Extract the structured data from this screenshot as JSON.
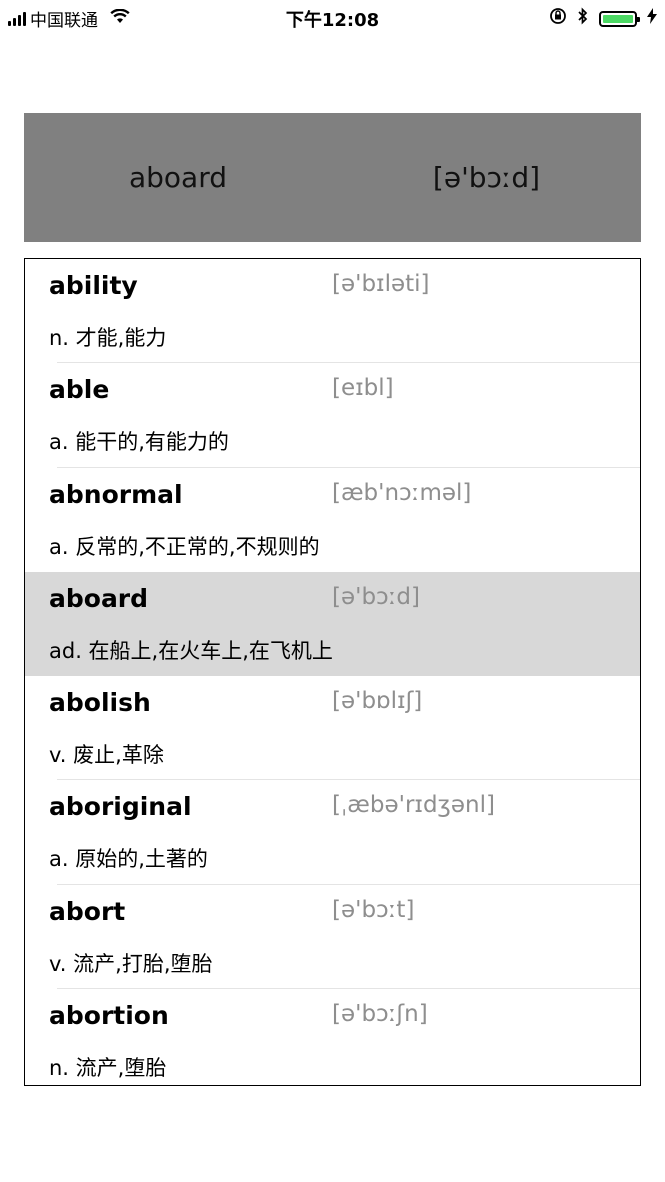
{
  "status_bar": {
    "carrier": "中国联通",
    "time": "下午12:08"
  },
  "header": {
    "word": "aboard",
    "phonetic": "[ə'bɔːd]"
  },
  "entries": [
    {
      "word": "ability",
      "phonetic": "[ə'bɪləti]",
      "definition": "n. 才能,能力",
      "selected": false
    },
    {
      "word": "able",
      "phonetic": "[eɪbl]",
      "definition": "a. 能干的,有能力的",
      "selected": false
    },
    {
      "word": "abnormal",
      "phonetic": "[æb'nɔːməl]",
      "definition": "a. 反常的,不正常的,不规则的",
      "selected": false
    },
    {
      "word": "aboard",
      "phonetic": "[ə'bɔːd]",
      "definition": "ad. 在船上,在火车上,在飞机上",
      "selected": true
    },
    {
      "word": "abolish",
      "phonetic": "[ə'bɒlɪʃ]",
      "definition": "v. 废止,革除",
      "selected": false
    },
    {
      "word": "aboriginal",
      "phonetic": "[ˌæbə'rɪdʒənl]",
      "definition": "a. 原始的,土著的",
      "selected": false
    },
    {
      "word": "abort",
      "phonetic": "[ə'bɔːt]",
      "definition": "v. 流产,打胎,堕胎",
      "selected": false
    },
    {
      "word": "abortion",
      "phonetic": "[ə'bɔːʃn]",
      "definition": "n. 流产,堕胎",
      "selected": false
    }
  ]
}
